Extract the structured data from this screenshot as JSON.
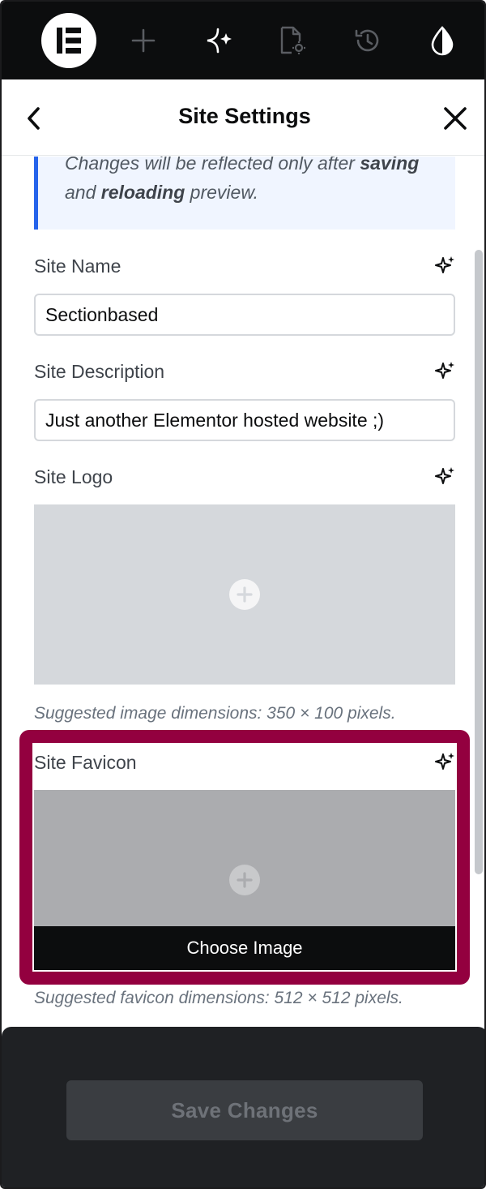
{
  "toolbar": {
    "icons": [
      "elementor-logo-icon",
      "add-element-icon",
      "ai-sparkle-icon",
      "page-settings-icon",
      "history-icon",
      "site-settings-droplet-icon"
    ]
  },
  "header": {
    "title": "Site Settings",
    "back_icon": "chevron-left-icon",
    "close_icon": "close-icon"
  },
  "notice": {
    "text_part1": "Changes will be reflected only after ",
    "bold1": "saving",
    "text_part2": " and ",
    "bold2": "reloading",
    "text_part3": " preview."
  },
  "fields": {
    "site_name": {
      "label": "Site Name",
      "value": "Sectionbased"
    },
    "site_description": {
      "label": "Site Description",
      "value": "Just another Elementor hosted website ;)"
    },
    "site_logo": {
      "label": "Site Logo",
      "hint": "Suggested image dimensions: 350 × 100 pixels."
    },
    "site_favicon": {
      "label": "Site Favicon",
      "choose_label": "Choose Image",
      "hint": "Suggested favicon dimensions: 512 × 512 pixels."
    }
  },
  "footer": {
    "save_label": "Save Changes"
  },
  "colors": {
    "toolbar_bg": "#0c0d0e",
    "notice_accent": "#2563eb",
    "highlight": "#93003f",
    "footer_bg": "#1f2124"
  }
}
